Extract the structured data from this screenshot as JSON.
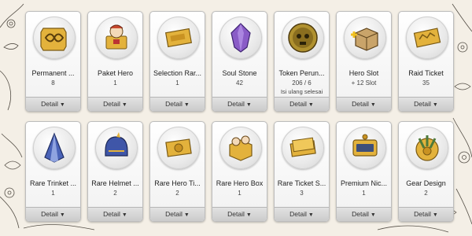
{
  "items": [
    {
      "name": "Permanent ...",
      "qty": "8",
      "note": "",
      "detail": "Detail",
      "icon": "infinity-scroll-icon"
    },
    {
      "name": "Paket Hero",
      "qty": "1",
      "note": "",
      "detail": "Detail",
      "icon": "hero-package-icon"
    },
    {
      "name": "Selection Rar...",
      "qty": "1",
      "note": "",
      "detail": "Detail",
      "icon": "selection-ticket-icon"
    },
    {
      "name": "Soul Stone",
      "qty": "42",
      "note": "",
      "detail": "Detail",
      "icon": "soul-stone-icon"
    },
    {
      "name": "Token Perun...",
      "qty": "206 / 6",
      "note": "Isi ulang selesai",
      "detail": "Detail",
      "icon": "skull-token-icon"
    },
    {
      "name": "Hero Slot",
      "qty": "+ 12 Slot",
      "note": "",
      "detail": "Detail",
      "icon": "slot-box-icon"
    },
    {
      "name": "Raid Ticket",
      "qty": "35",
      "note": "",
      "detail": "Detail",
      "icon": "raid-ticket-icon"
    },
    {
      "name": "Rare Trinket ...",
      "qty": "1",
      "note": "",
      "detail": "Detail",
      "icon": "cloak-trinket-icon"
    },
    {
      "name": "Rare Helmet ...",
      "qty": "2",
      "note": "",
      "detail": "Detail",
      "icon": "helmet-icon"
    },
    {
      "name": "Rare Hero Ti...",
      "qty": "2",
      "note": "",
      "detail": "Detail",
      "icon": "hero-ticket-icon"
    },
    {
      "name": "Rare Hero Box",
      "qty": "1",
      "note": "",
      "detail": "Detail",
      "icon": "hero-box-icon"
    },
    {
      "name": "Rare Ticket S...",
      "qty": "3",
      "note": "",
      "detail": "Detail",
      "icon": "rare-ticket-icon"
    },
    {
      "name": "Premium Nic...",
      "qty": "1",
      "note": "",
      "detail": "Detail",
      "icon": "name-tag-icon"
    },
    {
      "name": "Gear Design",
      "qty": "2",
      "note": "",
      "detail": "Detail",
      "icon": "gear-design-icon"
    }
  ],
  "colors": {
    "gold": "#e3b23c",
    "purple": "#8a5cc7",
    "blue": "#4a63b8",
    "panel": "#ffffff"
  }
}
